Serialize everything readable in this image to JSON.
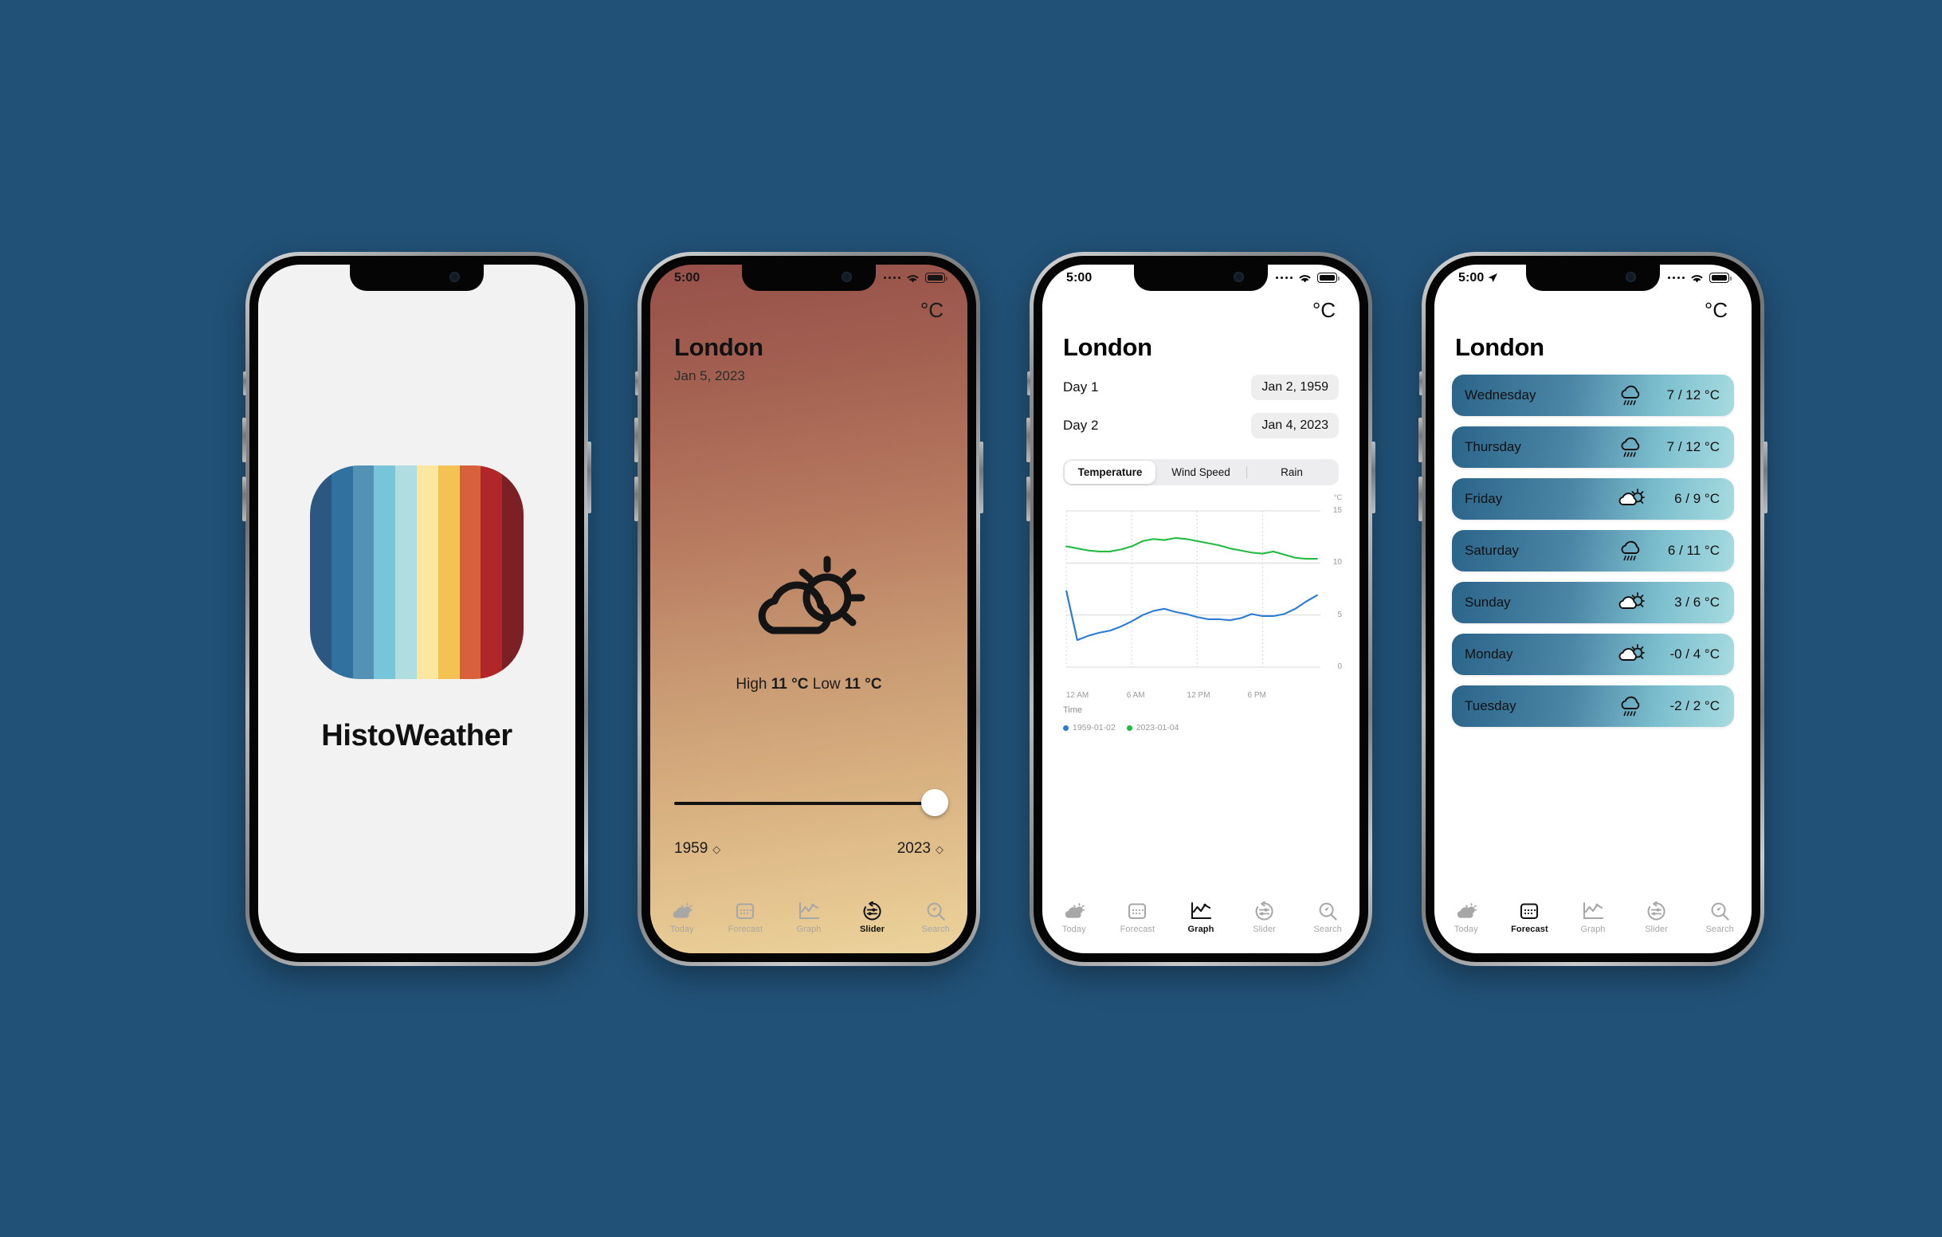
{
  "background_color": "#215177",
  "app": {
    "name": "HistoWeather"
  },
  "icon_stripes": [
    "#2b5781",
    "#31719f",
    "#5391b5",
    "#76c5da",
    "#b0dde0",
    "#fbe79f",
    "#f4c252",
    "#d8603b",
    "#b02629",
    "#7c2026"
  ],
  "tabs": [
    "Today",
    "Forecast",
    "Graph",
    "Slider",
    "Search"
  ],
  "tab_icons": [
    "cloud-sun-icon",
    "calendar-icon",
    "line-chart-icon",
    "slider-icon",
    "search-icon"
  ],
  "phone1": {
    "screen_name": "splash-screen",
    "app_title": "HistoWeather"
  },
  "phone2": {
    "screen_name": "slider-screen",
    "status": {
      "time": "5:00",
      "wifi": "wifi-icon",
      "battery": "battery-icon"
    },
    "unit": "°C",
    "city": "London",
    "date": "Jan 5, 2023",
    "weather_icon": "partly-cloudy-icon",
    "high_label": "High",
    "high_value": "11 °C",
    "low_label": "Low",
    "low_value": "11 °C",
    "slider": {
      "min_year": "1959",
      "max_year": "2023",
      "value_percent": 100
    },
    "active_tab": "Slider"
  },
  "phone3": {
    "screen_name": "graph-screen",
    "status": {
      "time": "5:00",
      "wifi": "wifi-icon",
      "battery": "battery-icon"
    },
    "unit": "°C",
    "city": "London",
    "day_rows": [
      {
        "label": "Day 1",
        "date": "Jan 2, 1959"
      },
      {
        "label": "Day 2",
        "date": "Jan 4, 2023"
      }
    ],
    "segments": [
      "Temperature",
      "Wind Speed",
      "Rain"
    ],
    "selected_segment": "Temperature",
    "active_tab": "Graph",
    "chart_data": {
      "type": "line",
      "title": "",
      "xlabel": "Time",
      "ylabel": "°C",
      "ylim": [
        0,
        15
      ],
      "yticks": [
        0,
        5,
        10,
        15
      ],
      "x": [
        "12 AM",
        "1 AM",
        "2 AM",
        "3 AM",
        "4 AM",
        "5 AM",
        "6 AM",
        "7 AM",
        "8 AM",
        "9 AM",
        "10 AM",
        "11 AM",
        "12 PM",
        "1 PM",
        "2 PM",
        "3 PM",
        "4 PM",
        "5 PM",
        "6 PM",
        "7 PM",
        "8 PM",
        "9 PM",
        "10 PM",
        "11 PM"
      ],
      "xticks": [
        "12 AM",
        "6 AM",
        "12 PM",
        "6 PM"
      ],
      "grid": true,
      "legend_position": "bottom-left",
      "series": [
        {
          "name": "1959-01-02",
          "color": "#2b7cd3",
          "values": [
            7.3,
            2.6,
            3.0,
            3.3,
            3.5,
            3.9,
            4.4,
            5.0,
            5.4,
            5.6,
            5.3,
            5.1,
            4.8,
            4.6,
            4.6,
            4.5,
            4.7,
            5.1,
            4.9,
            4.9,
            5.1,
            5.6,
            6.3,
            6.9
          ]
        },
        {
          "name": "2023-01-04",
          "color": "#22bb44",
          "values": [
            11.6,
            11.4,
            11.2,
            11.1,
            11.1,
            11.3,
            11.6,
            12.1,
            12.3,
            12.2,
            12.4,
            12.3,
            12.1,
            11.9,
            11.7,
            11.4,
            11.2,
            11.0,
            10.9,
            11.1,
            10.8,
            10.5,
            10.4,
            10.4
          ]
        }
      ]
    }
  },
  "phone4": {
    "screen_name": "forecast-screen",
    "status": {
      "time": "5:00",
      "location": "location-arrow-icon",
      "wifi": "wifi-icon",
      "battery": "battery-icon"
    },
    "unit": "°C",
    "city": "London",
    "active_tab": "Forecast",
    "forecast": [
      {
        "day": "Wednesday",
        "icon": "rain-icon",
        "temp": "7 / 12 °C"
      },
      {
        "day": "Thursday",
        "icon": "rain-icon",
        "temp": "7 / 12 °C"
      },
      {
        "day": "Friday",
        "icon": "cloud-sun-icon",
        "temp": "6 / 9 °C"
      },
      {
        "day": "Saturday",
        "icon": "rain-icon",
        "temp": "6 / 11 °C"
      },
      {
        "day": "Sunday",
        "icon": "cloud-sun-icon",
        "temp": "3 / 6 °C"
      },
      {
        "day": "Monday",
        "icon": "cloud-sun-icon",
        "temp": "-0 / 4 °C"
      },
      {
        "day": "Tuesday",
        "icon": "rain-icon",
        "temp": "-2 / 2 °C"
      }
    ],
    "row_gradient": {
      "from": "#2b6489",
      "to": "#a7dbe0"
    }
  }
}
